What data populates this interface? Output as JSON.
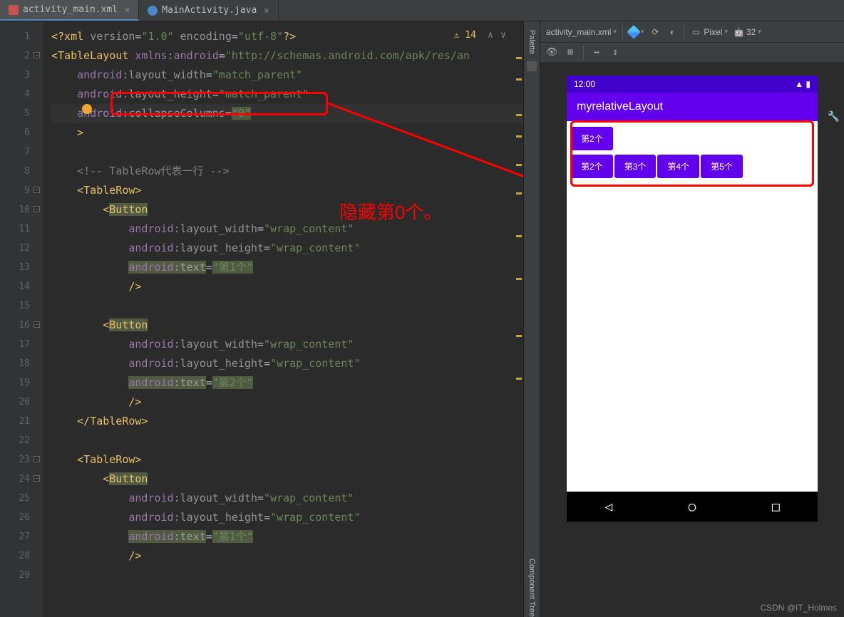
{
  "tabs": [
    {
      "label": "activity_main.xml",
      "active": true,
      "icon": "xml"
    },
    {
      "label": "MainActivity.java",
      "active": false,
      "icon": "java"
    }
  ],
  "editor": {
    "warning_count": "14",
    "lines": {
      "l1": {
        "n": "1"
      },
      "l2": {
        "n": "2"
      },
      "l3": {
        "n": "3"
      },
      "l4": {
        "n": "4"
      },
      "l5": {
        "n": "5"
      },
      "l6": {
        "n": "6"
      },
      "l7": {
        "n": "7"
      },
      "l8": {
        "n": "8"
      },
      "l9": {
        "n": "9"
      },
      "l10": {
        "n": "10"
      },
      "l11": {
        "n": "11"
      },
      "l12": {
        "n": "12"
      },
      "l13": {
        "n": "13"
      },
      "l14": {
        "n": "14"
      },
      "l15": {
        "n": "15"
      },
      "l16": {
        "n": "16"
      },
      "l17": {
        "n": "17"
      },
      "l18": {
        "n": "18"
      },
      "l19": {
        "n": "19"
      },
      "l20": {
        "n": "20"
      },
      "l21": {
        "n": "21"
      },
      "l22": {
        "n": "22"
      },
      "l23": {
        "n": "23"
      },
      "l24": {
        "n": "24"
      },
      "l25": {
        "n": "25"
      },
      "l26": {
        "n": "26"
      },
      "l27": {
        "n": "27"
      },
      "l28": {
        "n": "28"
      },
      "l29": {
        "n": "29"
      }
    },
    "code": {
      "xmlDeclVersion": "\"1.0\"",
      "xmlDeclEncoding": "\"utf-8\"",
      "tableLayout": "TableLayout",
      "xmlnsAndroid": "\"http://schemas.android.com/apk/res/an",
      "layoutWidth": "layout_width",
      "matchParent": "\"match_parent\"",
      "layoutHeight": "layout_height",
      "collapseColumns": "collapseColumns",
      "collapseVal": "\"0\"",
      "comment": "<!-- TableRow代表一行 -->",
      "tableRow": "TableRow",
      "button": "Button",
      "wrapContent": "\"wrap_content\"",
      "text": "text",
      "text1": "\"第1个\"",
      "text2": "\"第2个\"",
      "androidNs": "android",
      "xmlnsNs": "xmlns"
    }
  },
  "annotation": "隐藏第0个。",
  "palette": {
    "label": "Palette"
  },
  "componentTree": {
    "label": "Component Tree"
  },
  "design": {
    "file": "activity_main.xml",
    "device": "Pixel",
    "api": "32"
  },
  "preview": {
    "time": "12:00",
    "appTitle": "myrelativeLayout",
    "row1": [
      "第2个"
    ],
    "row2": [
      "第2个",
      "第3个",
      "第4个",
      "第5个"
    ]
  },
  "watermark": "CSDN @IT_Holmes",
  "icons": {
    "warn": "⚠",
    "up": "∧",
    "down": "∨",
    "wifi": "▲",
    "battery": "▮",
    "back": "◁",
    "home": "○",
    "recent": "□",
    "eye": "👁",
    "grid": "⊞",
    "swap": "↔",
    "harrow": "↕",
    "android": "🤖",
    "wrench": "🔧",
    "rotate": "⟳",
    "phone": "▭"
  }
}
